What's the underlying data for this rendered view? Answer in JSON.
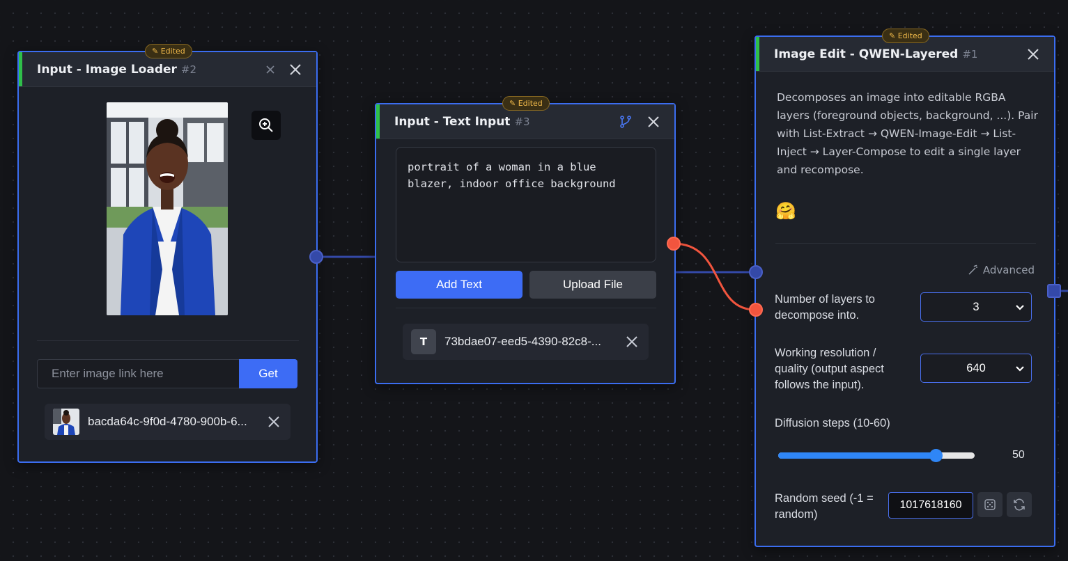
{
  "image_loader": {
    "title": "Input - Image Loader",
    "node_id": "#2",
    "badge": "✎ Edited",
    "url_placeholder": "Enter image link here",
    "get_label": "Get",
    "file_name": "bacda64c-9f0d-4780-900b-6..."
  },
  "text_input": {
    "title": "Input - Text Input",
    "node_id": "#3",
    "badge": "✎ Edited",
    "text": "portrait of a woman in a blue\nblazer, indoor office background",
    "add_text_label": "Add Text",
    "upload_label": "Upload File",
    "file_icon": "T",
    "file_name": "73bdae07-eed5-4390-82c8-..."
  },
  "image_edit": {
    "title": "Image Edit - QWEN-Layered",
    "node_id": "#1",
    "badge": "✎ Edited",
    "description": "Decomposes an image into editable RGBA layers (foreground objects, background, ...). Pair with List-Extract → QWEN-Image-Edit → List-Inject → Layer-Compose to edit a single layer and recompose.",
    "emoji": "🤗",
    "advanced_label": "Advanced",
    "layers_label": "Number of layers to decompose into.",
    "layers_value": "3",
    "resolution_label": "Working resolution / quality (output aspect follows the input).",
    "resolution_value": "640",
    "steps_label": "Diffusion steps (10-60)",
    "steps_value": "50",
    "steps_fraction": 0.8,
    "seed_label": "Random seed (-1 = random)",
    "seed_value": "1017618160"
  },
  "colors": {
    "accent": "#3d6cf5",
    "node_border": "#3b6df0",
    "header_strip": "#2fbf4a",
    "wire_blue": "#3449a8",
    "wire_red": "#f2553e",
    "badge_text": "#f0b94a"
  }
}
